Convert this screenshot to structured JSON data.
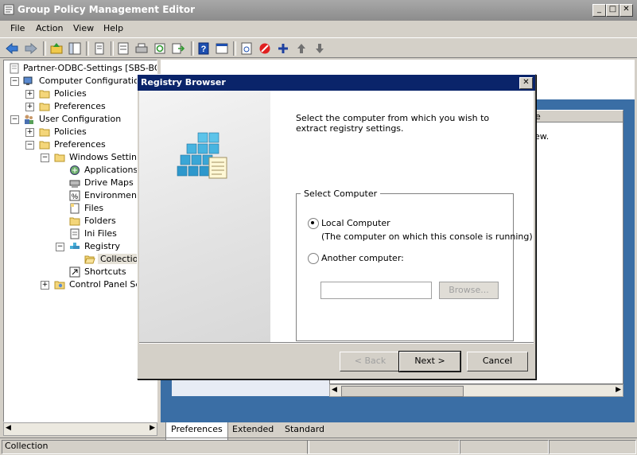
{
  "window": {
    "title": "Group Policy Management Editor",
    "controls": [
      "_",
      "□",
      "✕"
    ]
  },
  "menu": [
    "File",
    "Action",
    "View",
    "Help"
  ],
  "toolbar": {
    "icons": [
      "back-icon",
      "forward-icon",
      "up-folder-icon",
      "show-hide-tree-icon",
      "copy-icon",
      "properties-icon",
      "print-icon",
      "refresh-icon",
      "export-icon",
      "help-icon",
      "properties-sheet-icon",
      "xml-icon",
      "stop-icon",
      "add-icon",
      "up-arrow-icon",
      "down-arrow-icon"
    ]
  },
  "tree": {
    "root": "Partner-ODBC-Settings [SBS-BORC",
    "computer_config": "Computer Configuration",
    "cc_policies": "Policies",
    "cc_preferences": "Preferences",
    "user_config": "User Configuration",
    "uc_policies": "Policies",
    "uc_preferences": "Preferences",
    "windows_settings": "Windows Settings",
    "applications": "Applications",
    "drive_maps": "Drive Maps",
    "environment": "Environment",
    "files": "Files",
    "folders": "Folders",
    "ini_files": "Ini Files",
    "registry": "Registry",
    "collection": "Collection",
    "shortcuts": "Shortcuts",
    "control_panel": "Control Panel Sett"
  },
  "right_pane": {
    "column_fragment": "e",
    "view_fragment": "ew."
  },
  "tabs": [
    "Preferences",
    "Extended",
    "Standard"
  ],
  "status": {
    "text": "Collection"
  },
  "dialog": {
    "title": "Registry Browser",
    "description": "Select the computer from which you wish to extract registry settings.",
    "group_label": "Select Computer",
    "local_label": "Local Computer",
    "local_hint": "(The computer on which this console is running)",
    "another_label": "Another computer:",
    "computer_value": "",
    "browse": "Browse...",
    "back": "< Back",
    "next": "Next >",
    "cancel": "Cancel",
    "selected": "local"
  },
  "colors": {
    "dialog_title": "#0a246a",
    "right_bg": "#3a6ea5",
    "selection": "#f6f3c8"
  }
}
